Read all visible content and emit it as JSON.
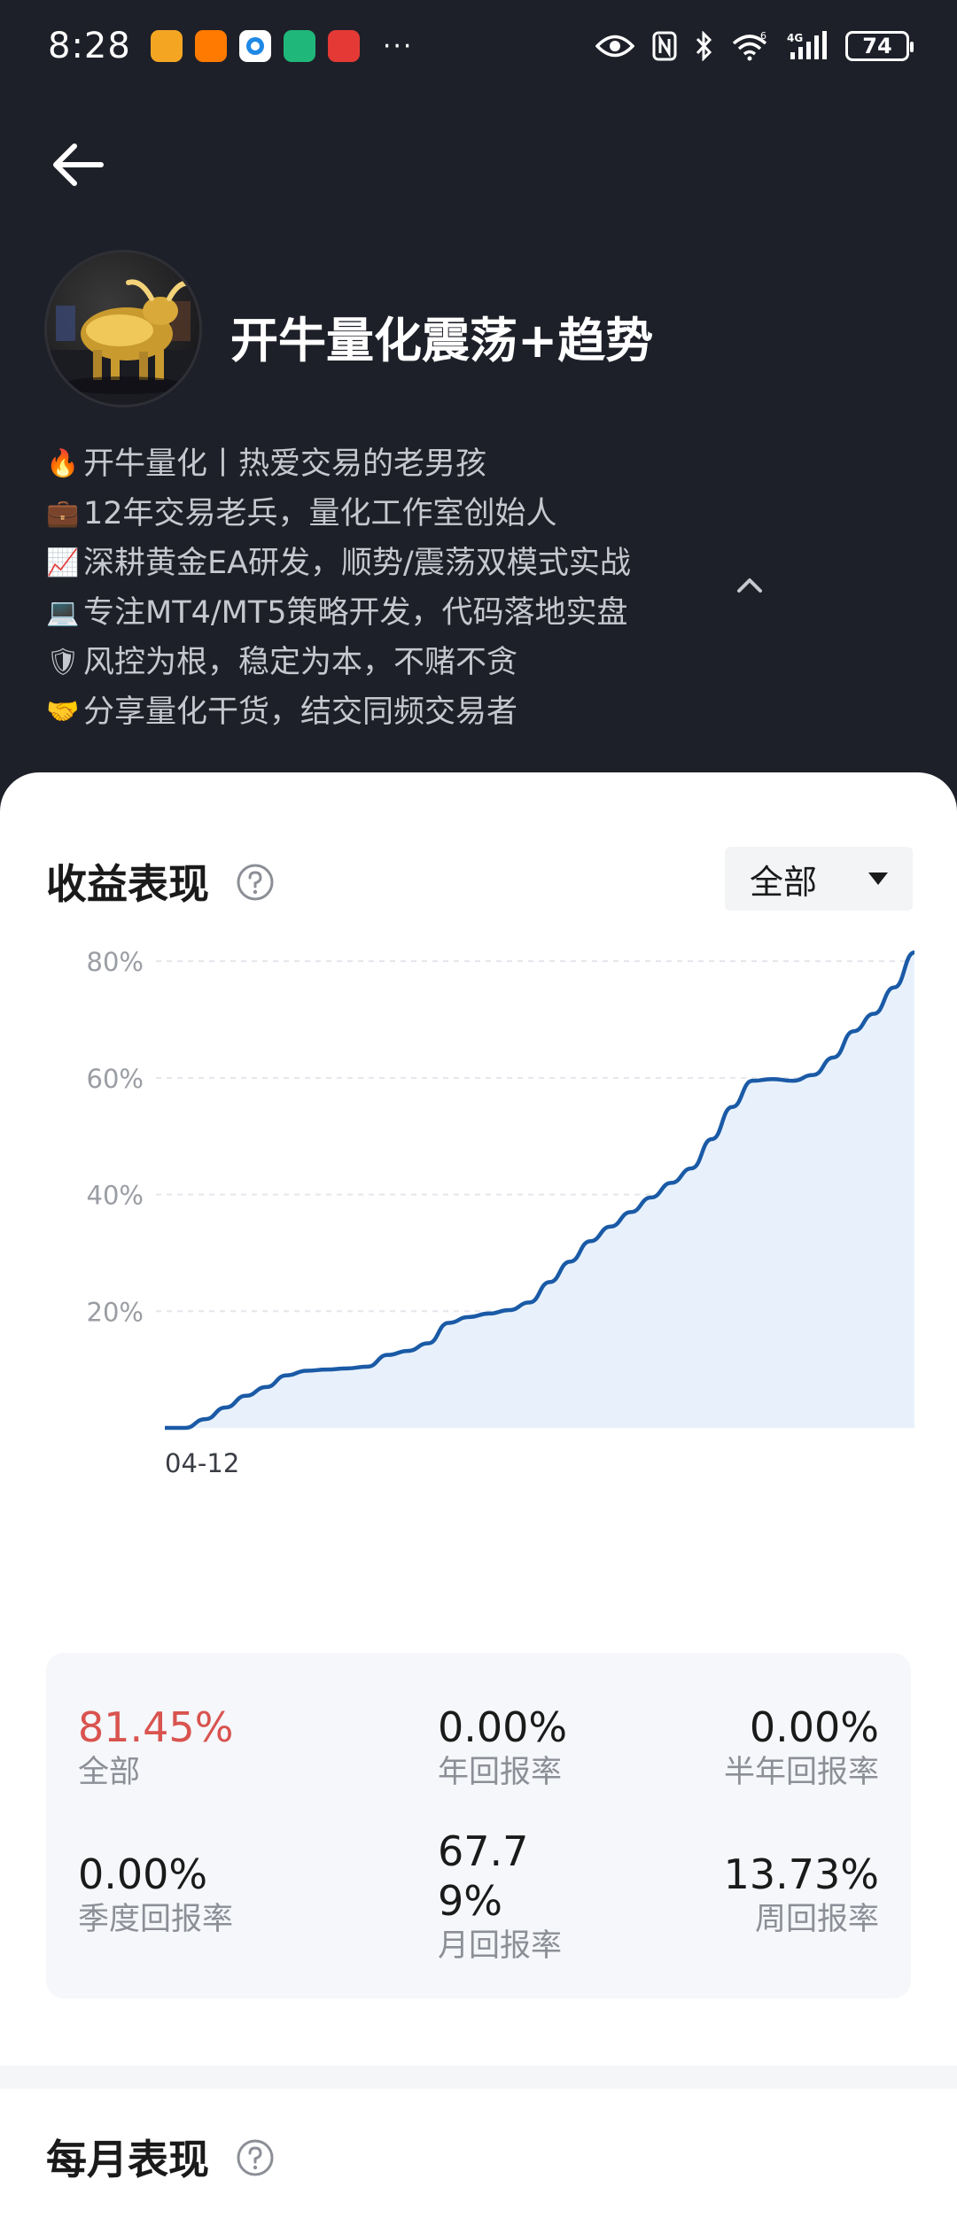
{
  "status_bar": {
    "time": "8:28",
    "battery": "74",
    "network": "4G",
    "wifi_superscript": "6",
    "app_icons": [
      {
        "name": "weibo-icon",
        "color": "#f4a623"
      },
      {
        "name": "taobao-icon",
        "color": "#ff7a00"
      },
      {
        "name": "browser-icon",
        "color": "#1e88e5"
      },
      {
        "name": "green-app-icon",
        "color": "#1fb87a"
      },
      {
        "name": "red-app-icon",
        "color": "#e53935"
      }
    ],
    "more": "···"
  },
  "profile": {
    "name": "开牛量化震荡+趋势",
    "bio": [
      {
        "emoji": "🔥",
        "text": "开牛量化丨热爱交易的老男孩"
      },
      {
        "emoji": "💼",
        "text": "12年交易老兵，量化工作室创始人"
      },
      {
        "emoji": "📈",
        "text": "深耕黄金EA研发，顺势/震荡双模式实战"
      },
      {
        "emoji": "💻",
        "text": "专注MT4/MT5策略开发，代码落地实盘"
      },
      {
        "emoji": "🛡",
        "text": "风控为根，稳定为本，不赌不贪"
      },
      {
        "emoji": "🤝",
        "text": "分享量化干货，结交同频交易者"
      }
    ]
  },
  "performance": {
    "title": "收益表现",
    "filter": "全部"
  },
  "chart_data": {
    "type": "area",
    "x_start_label": "04-12",
    "y_ticks": [
      "80%",
      "60%",
      "40%",
      "20%"
    ],
    "ylim": [
      0,
      82
    ],
    "grid": true,
    "x": [
      0,
      0.02,
      0.04,
      0.06,
      0.08,
      0.1,
      0.12,
      0.14,
      0.16,
      0.18,
      0.2,
      0.22,
      0.24,
      0.26,
      0.28,
      0.3,
      0.32,
      0.34,
      0.36,
      0.38,
      0.4,
      0.42,
      0.44,
      0.46,
      0.48,
      0.5,
      0.52,
      0.54,
      0.56,
      0.58,
      0.6,
      0.62,
      0.64,
      0.66,
      0.68,
      0.7,
      0.72,
      0.74,
      0.76,
      0.78,
      0.8,
      0.82,
      0.84,
      0.86,
      0.88,
      0.9,
      0.92,
      0.94,
      0.96,
      0.98,
      1.0
    ],
    "values": [
      0,
      0,
      1.5,
      3.5,
      5.5,
      7,
      9,
      9.8,
      10,
      10.2,
      10.5,
      12.5,
      13.2,
      14.5,
      18,
      19,
      19.6,
      20.2,
      21.5,
      25,
      28.5,
      32,
      34.5,
      37,
      39.5,
      42,
      44.5,
      49.5,
      55,
      59.5,
      59.8,
      59.5,
      60.5,
      63.5,
      68,
      71,
      75.5,
      81.5
    ]
  },
  "stats": [
    {
      "value": "81.45%",
      "label": "全部",
      "highlight": true
    },
    {
      "value": "0.00%",
      "label": "年回报率"
    },
    {
      "value": "0.00%",
      "label": "半年回报率"
    },
    {
      "value": "0.00%",
      "label": "季度回报率"
    },
    {
      "value": "67.79%",
      "label": "月回报率"
    },
    {
      "value": "13.73%",
      "label": "周回报率"
    }
  ],
  "monthly": {
    "title": "每月表现"
  },
  "colors": {
    "header_bg": "#1e2029",
    "line": "#1a5aa6",
    "area": "#e8f1fb",
    "highlight": "#d9534f"
  }
}
